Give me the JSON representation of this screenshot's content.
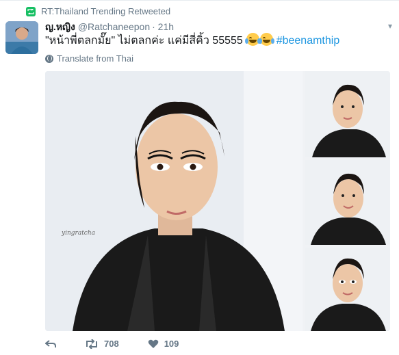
{
  "retweet_context": {
    "label": "RT:Thailand Trending Retweeted"
  },
  "author": {
    "display_name": "ญ.หญิง",
    "handle": "@Ratchaneepon",
    "time": "· 21h"
  },
  "tweet": {
    "text": "\"หน้าพี่ตลกมั๊ย\"  ไม่ตลกค่ะ แค่มีสี่คิ้ว 55555",
    "hashtag": "#beenamthip",
    "emoji_count": 2
  },
  "translate": {
    "label": "Translate from Thai"
  },
  "media": {
    "watermark": "yingratcha",
    "photo_count": 4
  },
  "actions": {
    "retweet_count": "708",
    "like_count": "109"
  },
  "colors": {
    "link": "#1b95e0",
    "muted": "#657786",
    "retweet_green": "#17bf63"
  }
}
